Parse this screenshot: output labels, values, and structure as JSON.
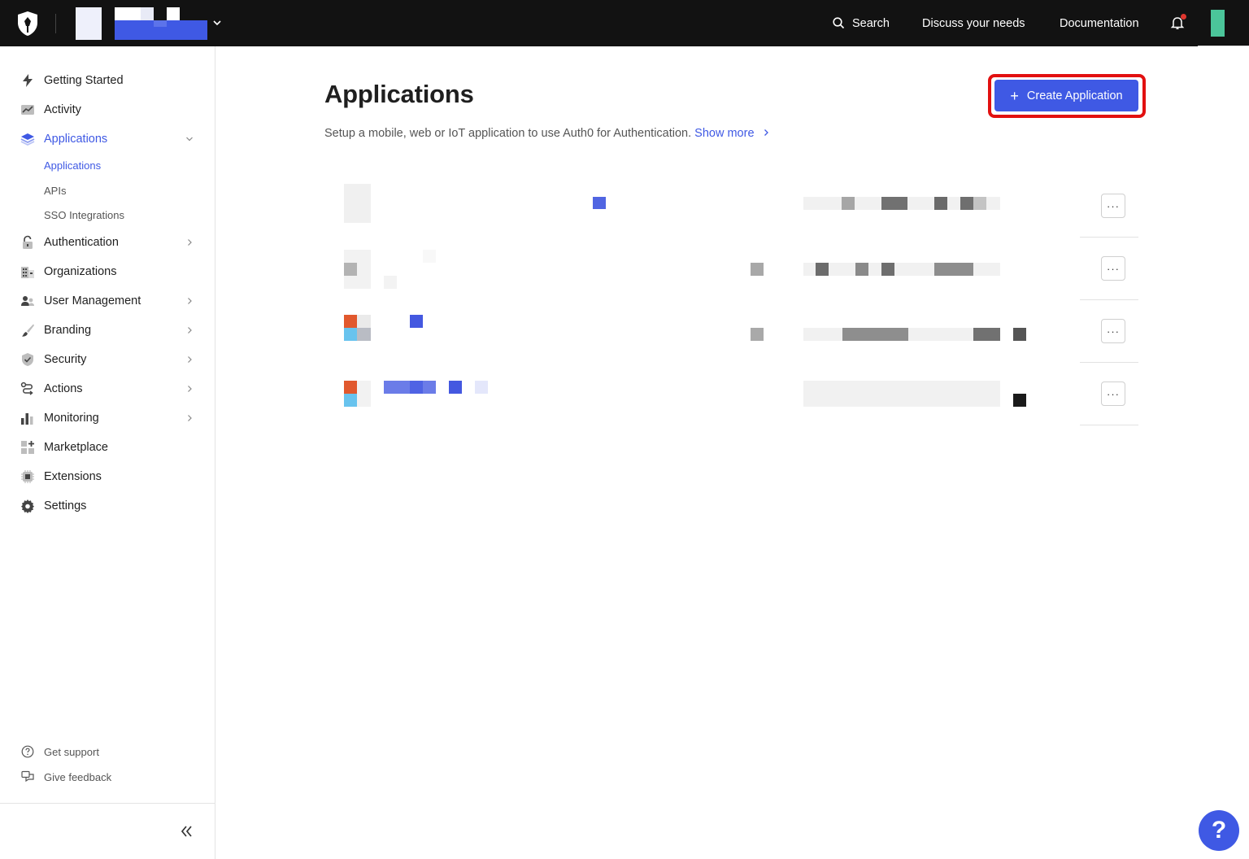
{
  "topbar": {
    "search_label": "Search",
    "discuss_label": "Discuss your needs",
    "docs_label": "Documentation"
  },
  "sidebar": {
    "items": [
      {
        "label": "Getting Started",
        "icon": "lightning-icon"
      },
      {
        "label": "Activity",
        "icon": "activity-icon"
      },
      {
        "label": "Applications",
        "icon": "layers-icon",
        "active": true
      },
      {
        "label": "Authentication",
        "icon": "lock-icon"
      },
      {
        "label": "Organizations",
        "icon": "building-icon"
      },
      {
        "label": "User Management",
        "icon": "users-icon"
      },
      {
        "label": "Branding",
        "icon": "brush-icon"
      },
      {
        "label": "Security",
        "icon": "shield-icon"
      },
      {
        "label": "Actions",
        "icon": "actions-icon"
      },
      {
        "label": "Monitoring",
        "icon": "bar-chart-icon"
      },
      {
        "label": "Marketplace",
        "icon": "marketplace-icon"
      },
      {
        "label": "Extensions",
        "icon": "chip-icon"
      },
      {
        "label": "Settings",
        "icon": "gear-icon"
      }
    ],
    "subitems": [
      {
        "label": "Applications",
        "active": true
      },
      {
        "label": "APIs"
      },
      {
        "label": "SSO Integrations"
      }
    ],
    "footer": {
      "support_label": "Get support",
      "feedback_label": "Give feedback"
    }
  },
  "main": {
    "title": "Applications",
    "description": "Setup a mobile, web or IoT application to use Auth0 for Authentication.",
    "show_more_label": "Show more",
    "create_button_label": "Create Application",
    "row_menu_label": "···"
  },
  "help_label": "?",
  "colors": {
    "accent": "#3f59e4",
    "topbar": "#121212",
    "highlight": "#e21010",
    "avatar": "#4bc59a"
  }
}
